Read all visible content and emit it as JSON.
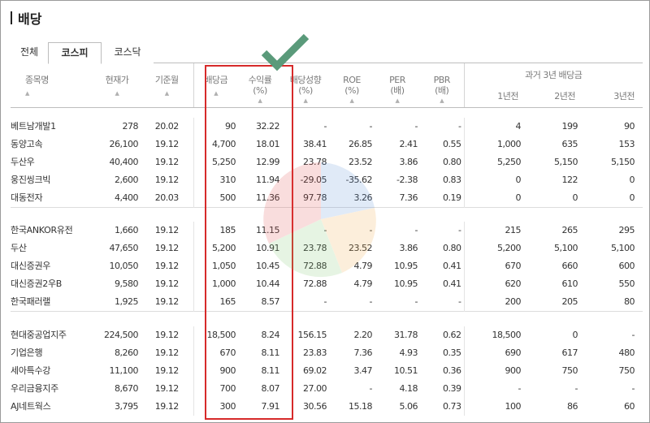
{
  "page": {
    "title": "배당"
  },
  "tabs": [
    {
      "label": "전체",
      "active": false
    },
    {
      "label": "코스피",
      "active": true
    },
    {
      "label": "코스닥",
      "active": false
    }
  ],
  "columns": {
    "name": "종목명",
    "price": "현재가",
    "base_month": "기준월",
    "dividend": "배당금",
    "yield": [
      "수익률",
      "(%)"
    ],
    "payout": [
      "배당성향",
      "(%)"
    ],
    "roe": [
      "ROE",
      "(%)"
    ],
    "per": [
      "PER",
      "(배)"
    ],
    "pbr": [
      "PBR",
      "(배)"
    ],
    "past_group": "과거 3년 배당금",
    "past": [
      "1년전",
      "2년전",
      "3년전"
    ]
  },
  "groups": [
    [
      [
        "베트남개발1",
        "278",
        "20.02",
        "90",
        "32.22",
        "-",
        "-",
        "-",
        "-",
        "4",
        "199",
        "90"
      ],
      [
        "동양고속",
        "26,100",
        "19.12",
        "4,700",
        "18.01",
        "38.41",
        "26.85",
        "2.41",
        "0.55",
        "1,000",
        "635",
        "153"
      ],
      [
        "두산우",
        "40,400",
        "19.12",
        "5,250",
        "12.99",
        "23.78",
        "23.52",
        "3.86",
        "0.80",
        "5,250",
        "5,150",
        "5,150"
      ],
      [
        "웅진씽크빅",
        "2,600",
        "19.12",
        "310",
        "11.94",
        "-29.05",
        "-35.62",
        "-2.38",
        "0.83",
        "0",
        "122",
        "0"
      ],
      [
        "대동전자",
        "4,400",
        "20.03",
        "500",
        "11.36",
        "97.78",
        "3.26",
        "7.36",
        "0.19",
        "0",
        "0",
        "0"
      ]
    ],
    [
      [
        "한국ANKOR유전",
        "1,660",
        "19.12",
        "185",
        "11.15",
        "-",
        "-",
        "-",
        "-",
        "215",
        "265",
        "295"
      ],
      [
        "두산",
        "47,650",
        "19.12",
        "5,200",
        "10.91",
        "23.78",
        "23.52",
        "3.86",
        "0.80",
        "5,200",
        "5,100",
        "5,100"
      ],
      [
        "대신증권우",
        "10,050",
        "19.12",
        "1,050",
        "10.45",
        "72.88",
        "4.79",
        "10.95",
        "0.41",
        "670",
        "660",
        "600"
      ],
      [
        "대신증권2우B",
        "9,580",
        "19.12",
        "1,000",
        "10.44",
        "72.88",
        "4.79",
        "10.95",
        "0.41",
        "620",
        "610",
        "550"
      ],
      [
        "한국패러랠",
        "1,925",
        "19.12",
        "165",
        "8.57",
        "-",
        "-",
        "-",
        "-",
        "200",
        "205",
        "80"
      ]
    ],
    [
      [
        "현대중공업지주",
        "224,500",
        "19.12",
        "18,500",
        "8.24",
        "156.15",
        "2.20",
        "31.78",
        "0.62",
        "18,500",
        "0",
        "-"
      ],
      [
        "기업은행",
        "8,260",
        "19.12",
        "670",
        "8.11",
        "23.83",
        "7.36",
        "4.93",
        "0.35",
        "690",
        "617",
        "480"
      ],
      [
        "세아특수강",
        "11,100",
        "19.12",
        "900",
        "8.11",
        "69.02",
        "3.47",
        "10.51",
        "0.36",
        "900",
        "750",
        "750"
      ],
      [
        "우리금융지주",
        "8,670",
        "19.12",
        "700",
        "8.07",
        "27.00",
        "-",
        "4.18",
        "0.39",
        "-",
        "-",
        "-"
      ],
      [
        "AJ네트웍스",
        "3,795",
        "19.12",
        "300",
        "7.91",
        "30.56",
        "15.18",
        "5.06",
        "0.73",
        "100",
        "86",
        "60"
      ]
    ]
  ],
  "colors": {
    "highlight": "#d62a2a",
    "check": "#5a9a7a"
  },
  "icons": {
    "check": "check-icon",
    "watermark": "watermark-icon",
    "sort": "sort-arrow-icon"
  }
}
